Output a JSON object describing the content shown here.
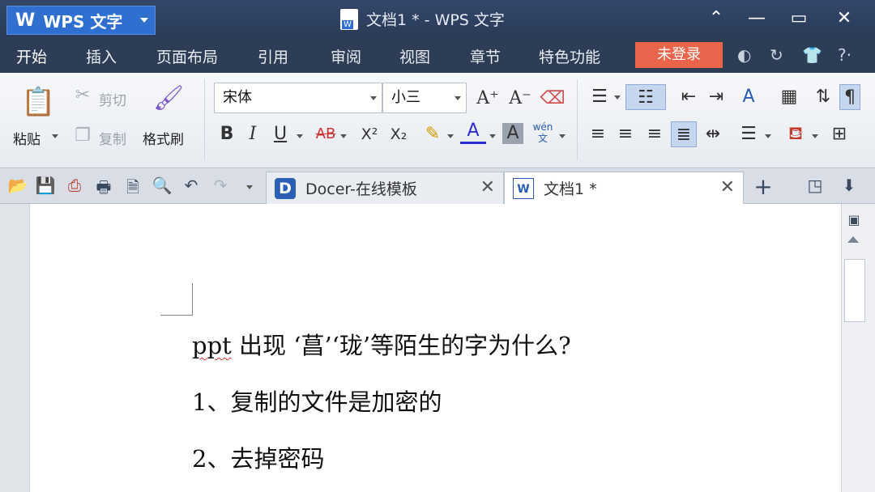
{
  "app": {
    "logo": "W",
    "name": "WPS 文字",
    "window_title": "文档1 * - WPS 文字"
  },
  "window_controls": [
    "⌃",
    "—",
    "▭",
    "✕"
  ],
  "menu": {
    "items": [
      "开始",
      "插入",
      "页面布局",
      "引用",
      "审阅",
      "视图",
      "章节",
      "特色功能"
    ],
    "login": "未登录",
    "extra_icons": [
      "◐",
      "↻",
      "👕",
      "?·"
    ]
  },
  "ribbon": {
    "paste": "粘贴",
    "cut": "剪切",
    "copy": "复制",
    "format_painter": "格式刷",
    "font_name": "宋体",
    "font_size": "小三",
    "bold": "B",
    "italic": "I",
    "underline": "U",
    "strike": "AB",
    "superscript": "X²",
    "subscript": "X₂",
    "font_color": "A",
    "char_shade": "A",
    "pinyin": "wén 文",
    "grow_font": "A⁺",
    "shrink_font": "A⁻"
  },
  "tabs": {
    "docer": "Docer-在线模板",
    "document": "文档1 *",
    "close": "✕",
    "new": "+"
  },
  "document": {
    "lines": [
      {
        "prefix": "ppt",
        "text": " 出现 ‘菖’‘珑’等陌生的字为什么?"
      },
      {
        "prefix": "",
        "text": "1、复制的文件是加密的"
      },
      {
        "prefix": "",
        "text": "2、去掉密码"
      }
    ]
  },
  "colors": {
    "titlebar": "#2c3d55",
    "app_button": "#2f6fd0",
    "login_button": "#e8644a",
    "ribbon": "#eef1f5"
  }
}
